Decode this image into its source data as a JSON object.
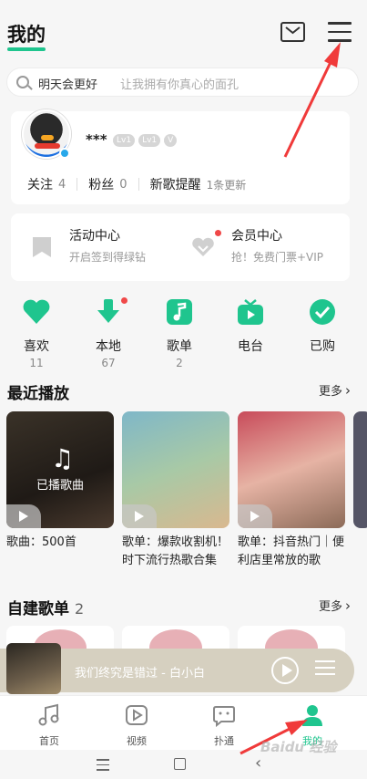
{
  "header": {
    "title": "我的"
  },
  "search": {
    "main": "明天会更好",
    "hint": "让我拥有你真心的面孔"
  },
  "profile": {
    "name": "***",
    "badges": [
      "Lv1",
      "Lv1"
    ],
    "stats": [
      {
        "label": "关注",
        "value": "4"
      },
      {
        "label": "粉丝",
        "value": "0"
      }
    ],
    "new_songs": {
      "label": "新歌提醒",
      "note": "1条更新"
    }
  },
  "activity": [
    {
      "title": "活动中心",
      "sub": "开启签到得绿钻"
    },
    {
      "title": "会员中心",
      "sub": "抢！免费门票+VIP"
    }
  ],
  "quick": [
    {
      "label": "喜欢",
      "num": "11"
    },
    {
      "label": "本地",
      "num": "67"
    },
    {
      "label": "歌单",
      "num": "2"
    },
    {
      "label": "电台",
      "num": ""
    },
    {
      "label": "已购",
      "num": ""
    }
  ],
  "recent": {
    "title": "最近播放",
    "more": "更多",
    "tiles": [
      {
        "overlay": "已播歌曲",
        "caption": "歌曲：500首"
      },
      {
        "overlay": "",
        "caption": "歌单：爆款收割机！时下流行热歌合集"
      },
      {
        "overlay": "",
        "caption": "歌单：抖音热门｜便利店里常放的歌"
      }
    ]
  },
  "playlists": {
    "title": "自建歌单",
    "count": "2",
    "more": "更多"
  },
  "player": {
    "title": "我们终究是错过 - 白小白"
  },
  "tabs": [
    {
      "label": "首页"
    },
    {
      "label": "视频"
    },
    {
      "label": "扑通"
    },
    {
      "label": "我的"
    }
  ],
  "colors": {
    "accent": "#1fc58e",
    "annotation": "#f03a3a",
    "dot": "#f04848"
  },
  "watermark": "Baidu 经验"
}
